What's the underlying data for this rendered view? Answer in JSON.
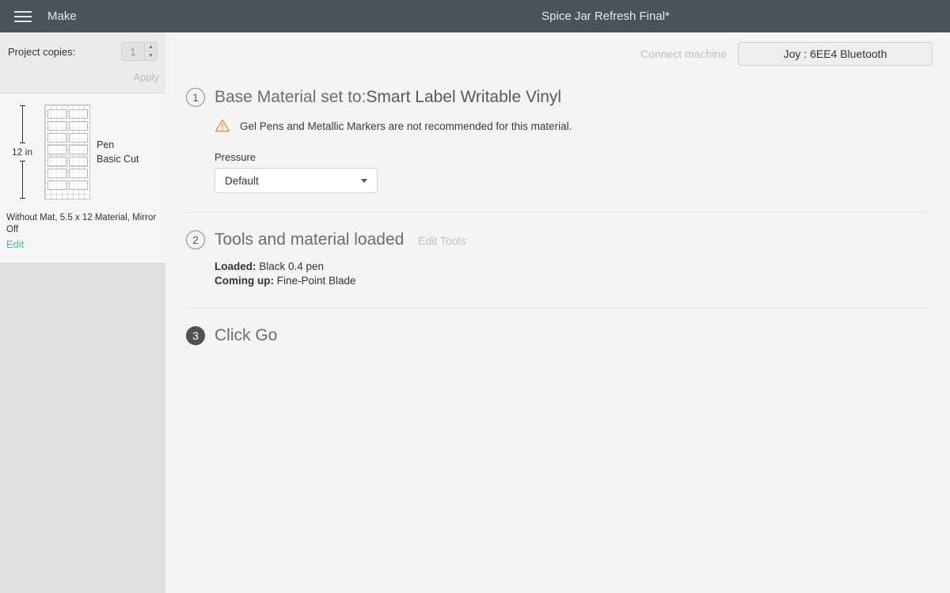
{
  "header": {
    "title": "Make",
    "project_name": "Spice Jar Refresh Final*"
  },
  "sidebar": {
    "copies_label": "Project copies:",
    "copies_value": "1",
    "apply_label": "Apply",
    "mat": {
      "height_label": "12 in",
      "operations": [
        "Pen",
        "Basic Cut"
      ],
      "description": "Without Mat, 5.5 x 12 Material, Mirror Off",
      "edit_label": "Edit"
    }
  },
  "machine": {
    "connect_label": "Connect machine",
    "selected": "Joy : 6EE4 Bluetooth"
  },
  "steps": {
    "s1": {
      "num": "1",
      "title_prefix": "Base Material set to:",
      "title_value": "Smart Label Writable Vinyl",
      "warning": "Gel Pens and Metallic Markers are not recommended for this material.",
      "pressure_label": "Pressure",
      "pressure_value": "Default"
    },
    "s2": {
      "num": "2",
      "title": "Tools and material loaded",
      "edit_tools_label": "Edit Tools",
      "loaded_label": "Loaded:",
      "loaded_value": "Black 0.4 pen",
      "coming_label": "Coming up:",
      "coming_value": "Fine-Point Blade"
    },
    "s3": {
      "num": "3",
      "title": "Click Go"
    }
  }
}
